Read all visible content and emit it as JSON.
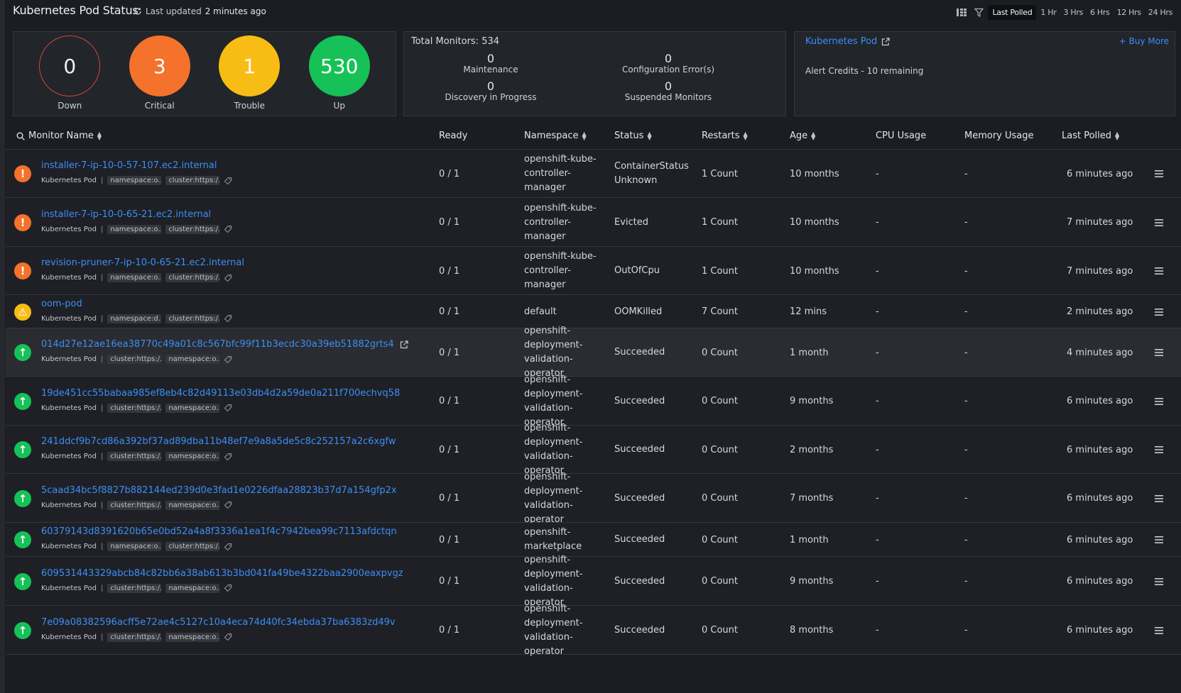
{
  "header": {
    "title": "Kubernetes Pod Status",
    "updated_prefix": "Last updated",
    "updated_value": "2 minutes ago",
    "time_filters": [
      "Last Polled",
      "1 Hr",
      "3 Hrs",
      "6 Hrs",
      "12 Hrs",
      "24 Hrs"
    ],
    "active_filter": "Last Polled"
  },
  "summary": {
    "down": {
      "count": "0",
      "label": "Down"
    },
    "critical": {
      "count": "3",
      "label": "Critical"
    },
    "trouble": {
      "count": "1",
      "label": "Trouble"
    },
    "up": {
      "count": "530",
      "label": "Up"
    }
  },
  "monitors_panel": {
    "title": "Total Monitors: 534",
    "maintenance": {
      "count": "0",
      "label": "Maintenance"
    },
    "config_errors": {
      "count": "0",
      "label": "Configuration Error(s)"
    },
    "discovery": {
      "count": "0",
      "label": "Discovery in Progress"
    },
    "suspended": {
      "count": "0",
      "label": "Suspended Monitors"
    }
  },
  "license_panel": {
    "link": "Kubernetes Pod",
    "buy_more": "+ Buy More",
    "credits": "Alert Credits - 10 remaining"
  },
  "columns": {
    "name": "Monitor Name",
    "ready": "Ready",
    "namespace": "Namespace",
    "status": "Status",
    "restarts": "Restarts",
    "age": "Age",
    "cpu": "CPU Usage",
    "memory": "Memory Usage",
    "polled": "Last Polled"
  },
  "rows": [
    {
      "state": "critical",
      "name": "installer-7-ip-10-0-57-107.ec2.internal",
      "type": "Kubernetes Pod",
      "tag1": "namespace:o...",
      "tag2": "cluster:https:/...",
      "ready": "0 / 1",
      "namespace": "openshift-kube-controller-manager",
      "status": "ContainerStatusUnknown",
      "restarts": "1 Count",
      "age": "10 months",
      "cpu": "-",
      "memory": "-",
      "polled": "6 minutes ago"
    },
    {
      "state": "critical",
      "name": "installer-7-ip-10-0-65-21.ec2.internal",
      "type": "Kubernetes Pod",
      "tag1": "namespace:o...",
      "tag2": "cluster:https:/...",
      "ready": "0 / 1",
      "namespace": "openshift-kube-controller-manager",
      "status": "Evicted",
      "restarts": "1 Count",
      "age": "10 months",
      "cpu": "-",
      "memory": "-",
      "polled": "7 minutes ago"
    },
    {
      "state": "critical",
      "name": "revision-pruner-7-ip-10-0-65-21.ec2.internal",
      "type": "Kubernetes Pod",
      "tag1": "namespace:o...",
      "tag2": "cluster:https:/...",
      "ready": "0 / 1",
      "namespace": "openshift-kube-controller-manager",
      "status": "OutOfCpu",
      "restarts": "1 Count",
      "age": "10 months",
      "cpu": "-",
      "memory": "-",
      "polled": "7 minutes ago"
    },
    {
      "state": "trouble",
      "name": "oom-pod",
      "type": "Kubernetes Pod",
      "tag1": "namespace:d...",
      "tag2": "cluster:https:/...",
      "ready": "0 / 1",
      "namespace": "default",
      "status": "OOMKilled",
      "restarts": "7 Count",
      "age": "12 mins",
      "cpu": "-",
      "memory": "-",
      "polled": "2 minutes ago"
    },
    {
      "state": "up",
      "name": "014d27e12ae16ea38770c49a01c8c567bfc99f11b3ecdc30a39eb51882grts4",
      "type": "Kubernetes Pod",
      "tag1": "cluster:https:/...",
      "tag2": "namespace:o...",
      "ready": "0 / 1",
      "namespace": "openshift-deployment-validation-operator",
      "status": "Succeeded",
      "restarts": "0 Count",
      "age": "1 month",
      "cpu": "-",
      "memory": "-",
      "polled": "4 minutes ago"
    },
    {
      "state": "up",
      "name": "19de451cc55babaa985ef8eb4c82d49113e03db4d2a59de0a211f700echvq58",
      "type": "Kubernetes Pod",
      "tag1": "cluster:https:/...",
      "tag2": "namespace:o...",
      "ready": "0 / 1",
      "namespace": "openshift-deployment-validation-operator",
      "status": "Succeeded",
      "restarts": "0 Count",
      "age": "9 months",
      "cpu": "-",
      "memory": "-",
      "polled": "6 minutes ago"
    },
    {
      "state": "up",
      "name": "241ddcf9b7cd86a392bf37ad89dba11b48ef7e9a8a5de5c8c252157a2c6xgfw",
      "type": "Kubernetes Pod",
      "tag1": "cluster:https:/...",
      "tag2": "namespace:o...",
      "ready": "0 / 1",
      "namespace": "openshift-deployment-validation-operator",
      "status": "Succeeded",
      "restarts": "0 Count",
      "age": "2 months",
      "cpu": "-",
      "memory": "-",
      "polled": "6 minutes ago"
    },
    {
      "state": "up",
      "name": "5caad34bc5f8827b882144ed239d0e3fad1e0226dfaa28823b37d7a154gfp2x",
      "type": "Kubernetes Pod",
      "tag1": "cluster:https:/...",
      "tag2": "namespace:o...",
      "ready": "0 / 1",
      "namespace": "openshift-deployment-validation-operator",
      "status": "Succeeded",
      "restarts": "0 Count",
      "age": "7 months",
      "cpu": "-",
      "memory": "-",
      "polled": "6 minutes ago"
    },
    {
      "state": "up",
      "name": "60379143d8391620b65e0bd52a4a8f3336a1ea1f4c7942bea99c7113afdctqn",
      "type": "Kubernetes Pod",
      "tag1": "namespace:o...",
      "tag2": "cluster:https:/...",
      "ready": "0 / 1",
      "namespace": "openshift-marketplace",
      "status": "Succeeded",
      "restarts": "0 Count",
      "age": "1 month",
      "cpu": "-",
      "memory": "-",
      "polled": "6 minutes ago"
    },
    {
      "state": "up",
      "name": "609531443329abcb84c82bb6a38ab613b3bd041fa49be4322baa2900eaxpvgz",
      "type": "Kubernetes Pod",
      "tag1": "cluster:https:/...",
      "tag2": "namespace:o...",
      "ready": "0 / 1",
      "namespace": "openshift-deployment-validation-operator",
      "status": "Succeeded",
      "restarts": "0 Count",
      "age": "9 months",
      "cpu": "-",
      "memory": "-",
      "polled": "6 minutes ago"
    },
    {
      "state": "up",
      "name": "7e09a08382596acff5e72ae4c5127c10a4eca74d40fc34ebda37ba6383zd49v",
      "type": "Kubernetes Pod",
      "tag1": "cluster:https:/...",
      "tag2": "namespace:o...",
      "ready": "0 / 1",
      "namespace": "openshift-deployment-validation-operator",
      "status": "Succeeded",
      "restarts": "0 Count",
      "age": "8 months",
      "cpu": "-",
      "memory": "-",
      "polled": "6 minutes ago"
    }
  ]
}
